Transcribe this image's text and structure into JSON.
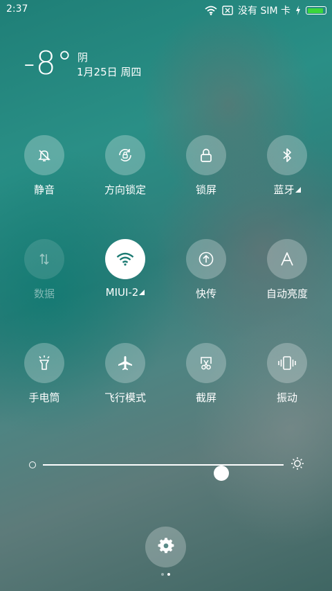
{
  "status_bar": {
    "time": "2:37",
    "carrier": "没有 SIM 卡",
    "icons": [
      "wifi-icon",
      "sim-card-icon",
      "charging-bolt-icon",
      "battery-icon"
    ],
    "battery_color": "#3bd63b"
  },
  "weather": {
    "temperature": "-8°",
    "condition": "阴",
    "date": "1月25日 周四"
  },
  "toggles": [
    {
      "label": "静音",
      "icon": "silent-bell-icon",
      "state": "off"
    },
    {
      "label": "方向锁定",
      "icon": "rotation-lock-icon",
      "state": "off"
    },
    {
      "label": "锁屏",
      "icon": "lock-icon",
      "state": "off"
    },
    {
      "label": "蓝牙",
      "icon": "bluetooth-icon",
      "state": "off",
      "expandable": true
    },
    {
      "label": "数据",
      "icon": "mobile-data-icon",
      "state": "disabled"
    },
    {
      "label": "MIUI-2",
      "icon": "wifi-icon",
      "state": "on",
      "expandable": true
    },
    {
      "label": "快传",
      "icon": "quick-transfer-icon",
      "state": "off"
    },
    {
      "label": "自动亮度",
      "icon": "auto-brightness-icon",
      "state": "off"
    },
    {
      "label": "手电筒",
      "icon": "flashlight-icon",
      "state": "off"
    },
    {
      "label": "飞行模式",
      "icon": "airplane-icon",
      "state": "off"
    },
    {
      "label": "截屏",
      "icon": "screenshot-icon",
      "state": "off"
    },
    {
      "label": "振动",
      "icon": "vibrate-icon",
      "state": "off"
    }
  ],
  "brightness": {
    "level": 0.74
  },
  "settings": {
    "icon": "gear-icon"
  },
  "pager": {
    "pages": 2,
    "current": 2
  }
}
